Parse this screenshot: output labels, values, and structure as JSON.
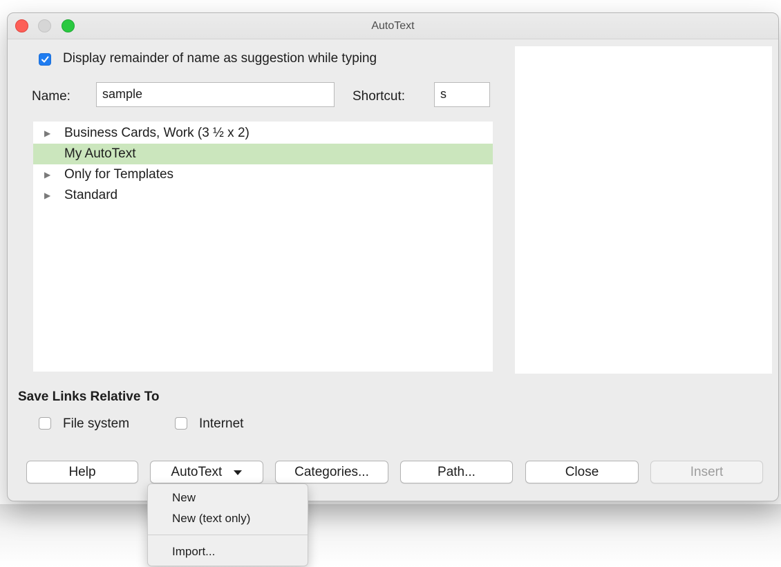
{
  "window": {
    "title": "AutoText"
  },
  "options": {
    "suggestion_label": "Display remainder of name as suggestion while typing",
    "suggestion_checked": true
  },
  "fields": {
    "name_label": "Name:",
    "name_value": "sample",
    "shortcut_label": "Shortcut:",
    "shortcut_value": "s"
  },
  "tree": {
    "items": [
      {
        "label": "Business Cards, Work (3 ½ x 2)",
        "expandable": true,
        "selected": false
      },
      {
        "label": "My AutoText",
        "expandable": false,
        "selected": true
      },
      {
        "label": "Only for Templates",
        "expandable": true,
        "selected": false
      },
      {
        "label": "Standard",
        "expandable": true,
        "selected": false
      }
    ]
  },
  "save_links": {
    "heading": "Save Links Relative To",
    "file_system_label": "File system",
    "file_system_checked": false,
    "internet_label": "Internet",
    "internet_checked": false
  },
  "buttons": {
    "help": "Help",
    "autotext": "AutoText",
    "categories": "Categories...",
    "path": "Path...",
    "close": "Close",
    "insert": "Insert"
  },
  "dropdown_menu": {
    "new": "New",
    "new_text_only": "New (text only)",
    "import": "Import..."
  },
  "icons": {
    "expander": "triangle-right-icon",
    "dropdown": "caret-down-icon",
    "checkmark": "checkmark-icon"
  },
  "colors": {
    "selection": "#cbe6bd",
    "checkbox_accent": "#1f7cf0"
  }
}
